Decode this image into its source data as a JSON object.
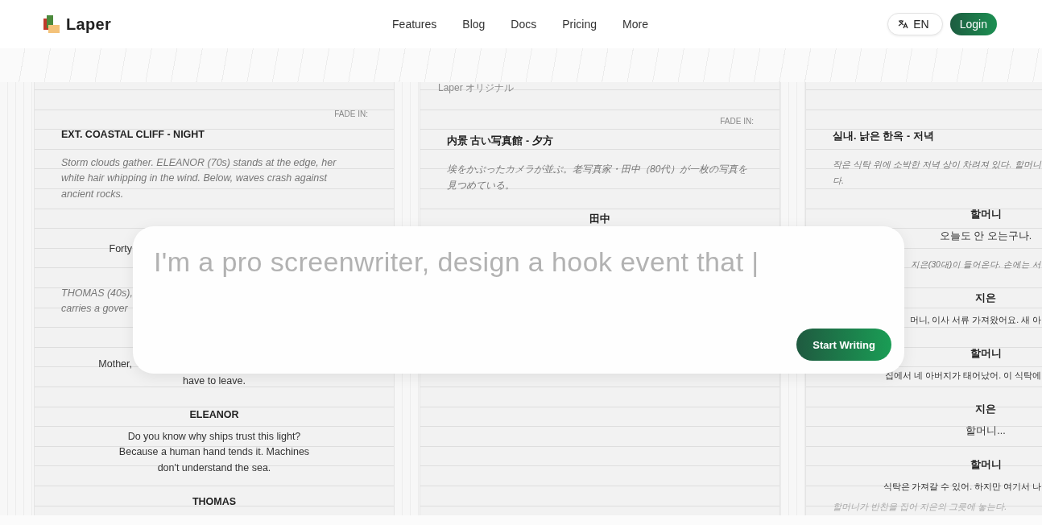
{
  "header": {
    "logo": "Laper",
    "nav": [
      "Features",
      "Blog",
      "Docs",
      "Pricing",
      "More"
    ],
    "language": "EN",
    "login": "Login"
  },
  "pages": [
    {
      "lines": [
        {
          "kind": "fade",
          "text": "FADE IN:"
        },
        {
          "kind": "scene",
          "text": "EXT. COASTAL CLIFF - NIGHT"
        },
        {
          "kind": "action",
          "text": "Storm clouds gather. ELEANOR (70s) stands at the edge, her\nwhite hair whipping in the wind. Below, waves crash against\nancient rocks."
        },
        {
          "kind": "cut",
          "text": "Forty"
        },
        {
          "kind": "action",
          "text": "THOMAS (40s),\ncarries a gover"
        },
        {
          "kind": "cut",
          "text": "Mother,"
        },
        {
          "kind": "dialogue",
          "text": "have to leave."
        },
        {
          "kind": "character",
          "text": "ELEANOR"
        },
        {
          "kind": "dialogue",
          "text": "Do you know why ships trust this light?\nBecause a human hand tends it. Machines\ndon't understand the sea."
        },
        {
          "kind": "character",
          "text": "THOMAS"
        }
      ]
    },
    {
      "lines": [
        {
          "kind": "label",
          "text": "Laper オリジナル"
        },
        {
          "kind": "fade",
          "text": "FADE IN:"
        },
        {
          "kind": "scene",
          "text": "内景 古い写真館 - 夕方"
        },
        {
          "kind": "action",
          "text": "埃をかぶったカメラが並ぶ。老写真家・田中（80代）が一枚の写真を見つめている。"
        },
        {
          "kind": "character",
          "text": "田中"
        }
      ]
    },
    {
      "lines": [
        {
          "kind": "scene",
          "text": "실내. 낡은 한옥 - 저녁"
        },
        {
          "kind": "action",
          "text": "작은 식탁 위에 소박한 저녁 상이 차려져 있다. 할머니\n다."
        },
        {
          "kind": "character",
          "text": "할머니"
        },
        {
          "kind": "dialogue",
          "text": "오늘도 안 오는구나."
        },
        {
          "kind": "cut-action",
          "text": "지은(30대)이 들어온다. 손에는 서"
        },
        {
          "kind": "character",
          "text": "지은"
        },
        {
          "kind": "cut",
          "text": "머니, 이사 서류 가져왔어요. 새 아"
        },
        {
          "kind": "character",
          "text": "할머니"
        },
        {
          "kind": "cut",
          "text": "집에서 네 아버지가 태어났어. 이 식탁에"
        },
        {
          "kind": "character",
          "text": "지은"
        },
        {
          "kind": "dialogue",
          "text": "할머니..."
        },
        {
          "kind": "character",
          "text": "할머니"
        },
        {
          "kind": "cut",
          "text": "식탁은 가져갈 수 있어. 하지만 여기서 나"
        },
        {
          "kind": "action",
          "text": "할머니가 반찬을 집어 지은의 그릇에 놓는다."
        }
      ]
    }
  ],
  "prompt": {
    "placeholder": "I'm a pro screenwriter, design a hook event that |",
    "button": "Start Writing"
  }
}
